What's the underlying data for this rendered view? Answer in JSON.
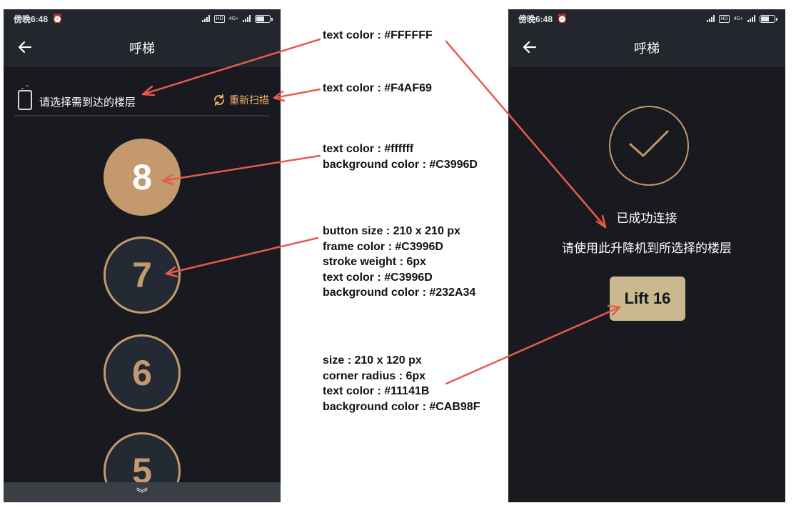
{
  "colors": {
    "accent": "#C3996D",
    "rescan": "#F4AF69",
    "lift_bg": "#CAB98F",
    "lift_text": "#11141B",
    "button_bg": "#232A34",
    "arrow": "#E85A4F"
  },
  "status_bar": {
    "time": "傍晚6:48",
    "alarm_icon": "alarm-clock-icon",
    "hd_label": "HD",
    "network_label": "4G+"
  },
  "left_screen": {
    "title": "呼梯",
    "select_prompt": "请选择需到达的楼层",
    "rescan_label": "重新扫描",
    "floors": [
      "8",
      "7",
      "6",
      "5"
    ],
    "selected_floor": "8",
    "bottom_icon": "double-chevron-down-icon",
    "bottom_glyph": "︾"
  },
  "right_screen": {
    "title": "呼梯",
    "connected_text": "已成功连接",
    "instruction_text": "请使用此升降机到所选择的楼层",
    "lift_label": "Lift 16"
  },
  "annotations": {
    "title_text": [
      "text color : #FFFFFF"
    ],
    "rescan_text": [
      "text color : #F4AF69"
    ],
    "selected_button": [
      "text color : #ffffff",
      "background color : #C3996D"
    ],
    "normal_button": [
      "button size : 210 x 210 px",
      "frame color : #C3996D",
      "stroke weight : 6px",
      "text color : #C3996D",
      "background color : #232A34"
    ],
    "lift_button": [
      "size : 210 x 120 px",
      "corner radius : 6px",
      "text color : #11141B",
      "background color : #CAB98F"
    ]
  }
}
